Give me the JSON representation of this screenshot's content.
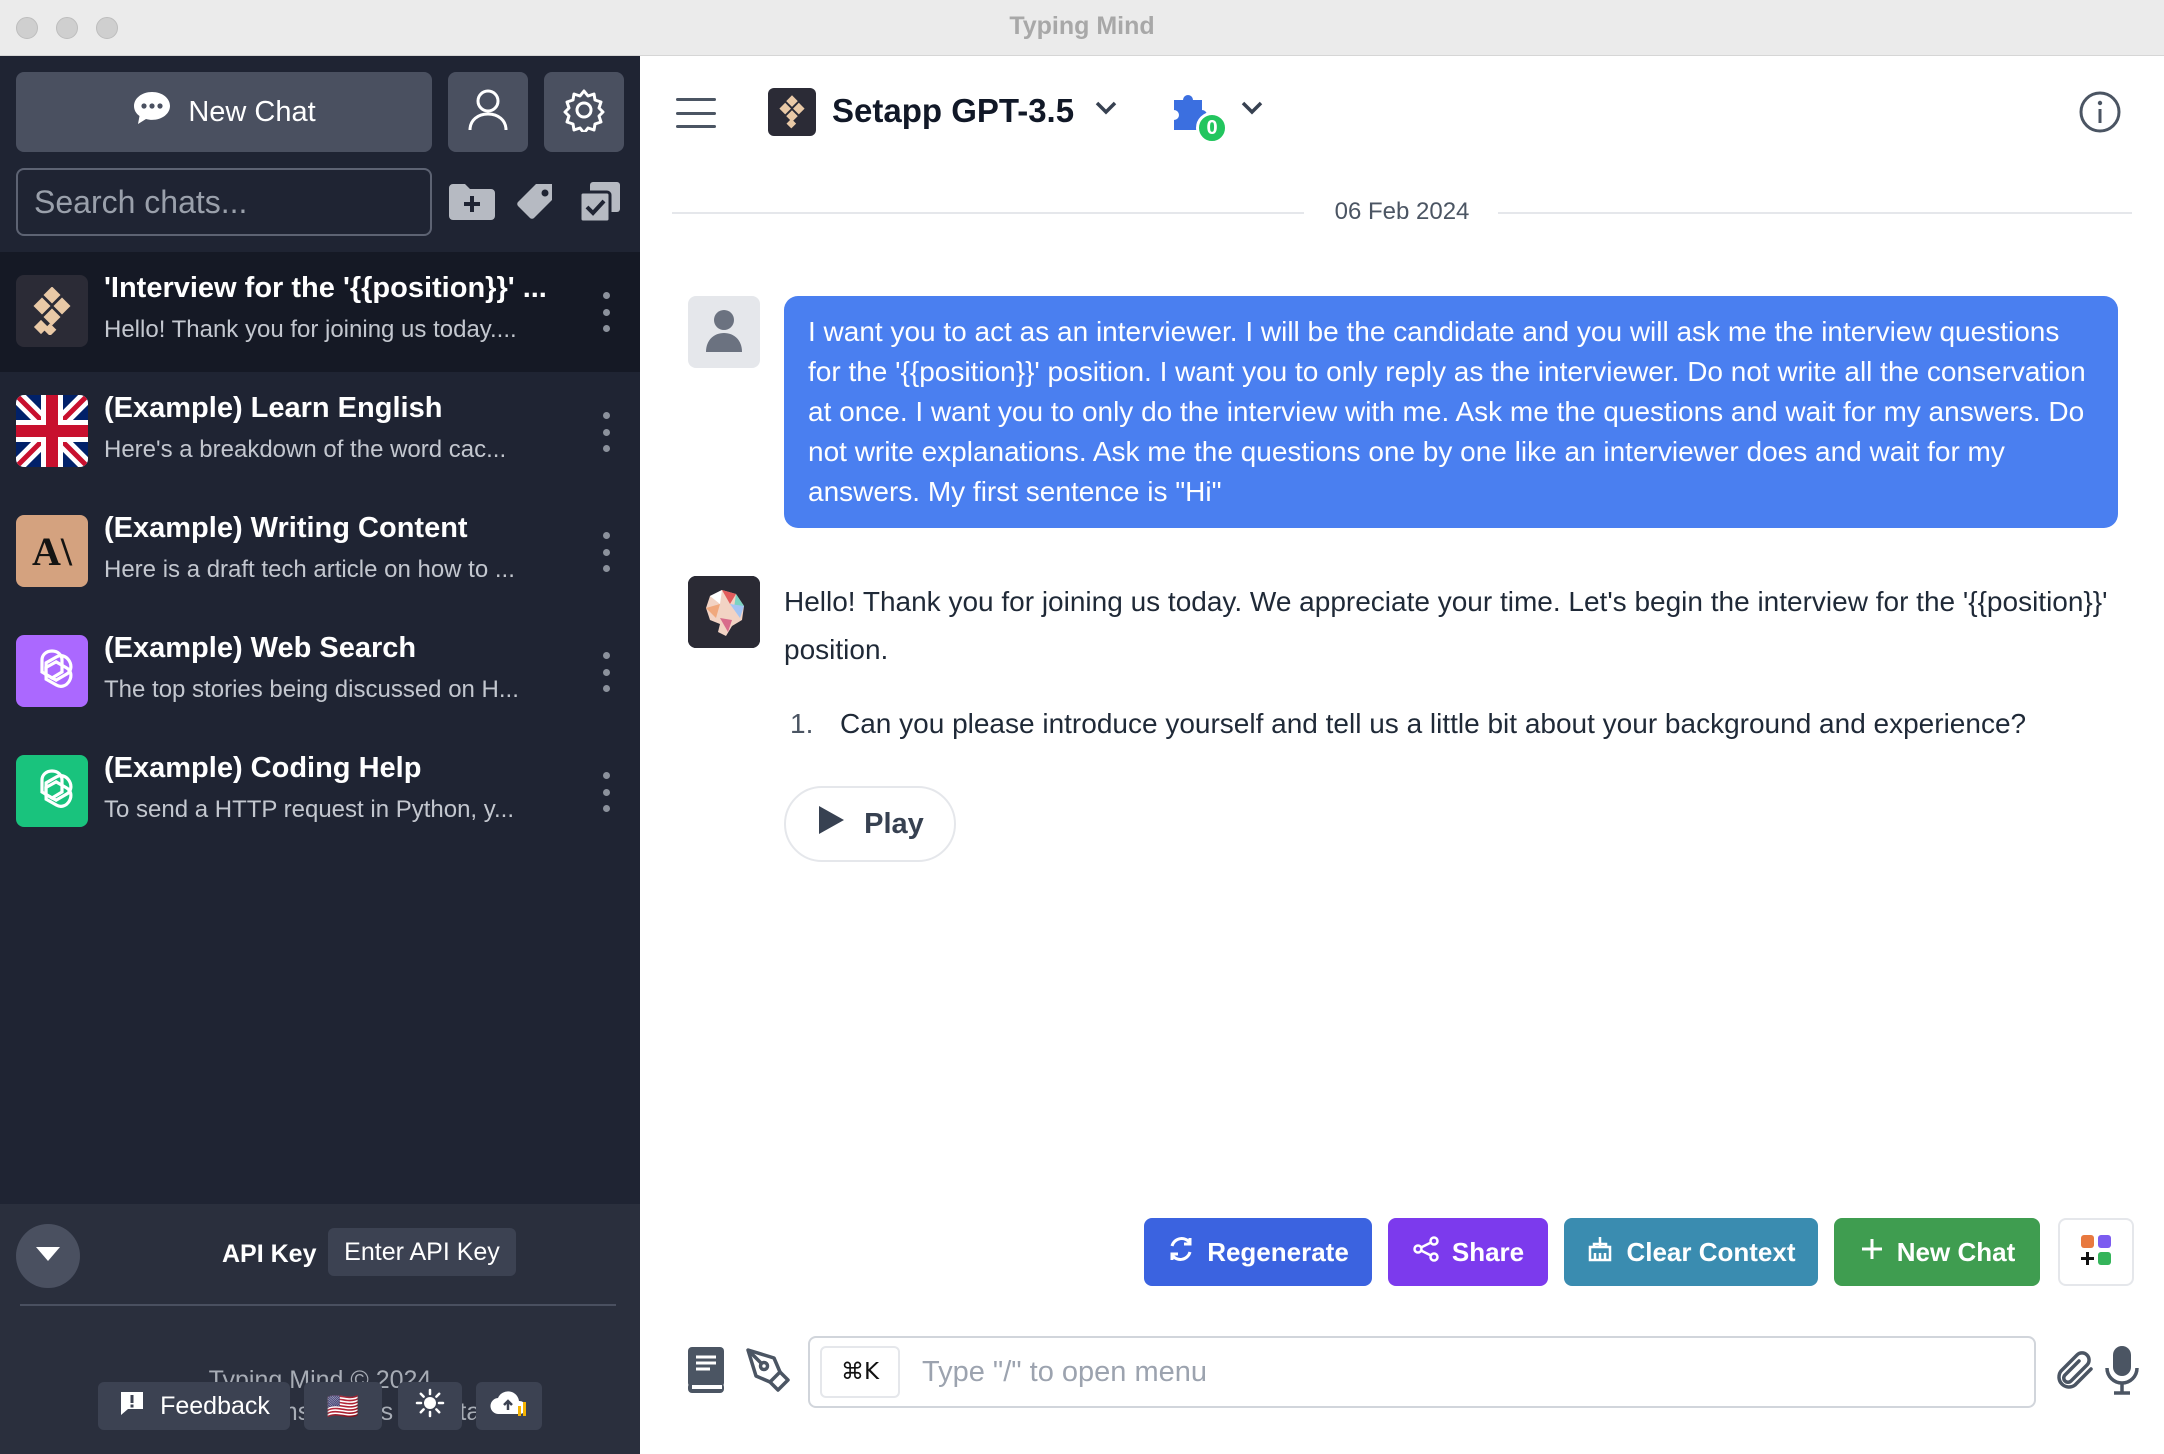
{
  "window": {
    "title": "Typing Mind"
  },
  "sidebar": {
    "new_chat_label": "New Chat",
    "search_placeholder": "Search chats...",
    "chats": [
      {
        "title": "'Interview for the '{{position}}' ...",
        "preview": "Hello! Thank you for joining us today....",
        "icon": "setapp-logo",
        "active": true
      },
      {
        "title": "(Example) Learn English",
        "preview": "Here's a breakdown of the word cac...",
        "icon": "uk-flag"
      },
      {
        "title": "(Example) Writing Content",
        "preview": "Here is a draft tech article on how to ...",
        "icon": "anthropic-logo",
        "icon_text": "A\\"
      },
      {
        "title": "(Example) Web Search",
        "preview": "The top stories being discussed on H...",
        "icon": "openai-logo-purple"
      },
      {
        "title": "(Example) Coding Help",
        "preview": "To send a HTTP request in Python, y...",
        "icon": "openai-logo-green"
      }
    ],
    "footer": {
      "api_key_label": "API Key",
      "enter_api_key_label": "Enter API Key",
      "copyright": "Typing Mind © 2024",
      "links": "Privacy | Terms | FAQs | Contact",
      "feedback_label": "Feedback",
      "flag_icon": "🇺🇸"
    }
  },
  "header": {
    "model_name": "Setapp GPT-3.5",
    "plugins_count": "0"
  },
  "conversation": {
    "date": "06 Feb 2024",
    "user_message": "I want you to act as an interviewer. I will be the candidate and you will ask me the interview questions for the '{{position}}' position. I want you to only reply as the interviewer. Do not write all the conservation at once. I want you to only do the interview with me. Ask me the questions and wait for my answers. Do not write explanations. Ask me the questions one by one like an interviewer does and wait for my answers. My first sentence is \"Hi\"",
    "assistant_intro": "Hello! Thank you for joining us today. We appreciate your time. Let's begin the interview for the '{{position}}' position.",
    "assistant_list": [
      {
        "num": "1.",
        "text": "Can you please introduce yourself and tell us a little bit about your background and experience?"
      }
    ],
    "play_label": "Play"
  },
  "actions": {
    "regenerate_label": "Regenerate",
    "share_label": "Share",
    "clear_context_label": "Clear Context",
    "new_chat_label": "New Chat",
    "colors": {
      "regenerate": "#3b63e0",
      "share": "#7c3aed",
      "clear": "#3a8cb0",
      "new_chat": "#3f9d50"
    }
  },
  "composer": {
    "shortcut": "⌘K",
    "placeholder": "Type \"/\" to open menu"
  }
}
